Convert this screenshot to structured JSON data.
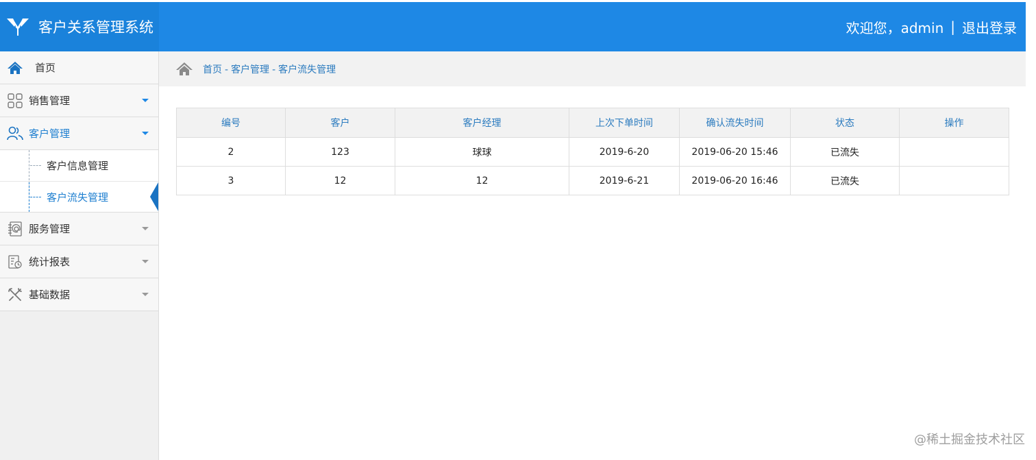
{
  "header": {
    "title": "客户关系管理系统",
    "welcome": "欢迎您，admin",
    "separator": "|",
    "logout": "退出登录"
  },
  "sidebar": {
    "home": "首页",
    "items": [
      {
        "label": "销售管理",
        "icon": "grid-icon"
      },
      {
        "label": "客户管理",
        "icon": "users-icon"
      },
      {
        "label": "服务管理",
        "icon": "contacts-book-icon"
      },
      {
        "label": "统计报表",
        "icon": "report-icon"
      },
      {
        "label": "基础数据",
        "icon": "tools-icon"
      }
    ],
    "submenu": [
      "客户信息管理",
      "客户流失管理"
    ]
  },
  "breadcrumb": [
    "首页",
    "客户管理",
    "客户流失管理"
  ],
  "breadcrumb_sep": "-",
  "table": {
    "columns": [
      "编号",
      "客户",
      "客户经理",
      "上次下单时间",
      "确认流失时间",
      "状态",
      "操作"
    ],
    "rows": [
      [
        "2",
        "123",
        "球球",
        "2019-6-20",
        "2019-06-20 15:46",
        "已流失",
        ""
      ],
      [
        "3",
        "12",
        "12",
        "2019-6-21",
        "2019-06-20 16:46",
        "已流失",
        ""
      ]
    ]
  },
  "watermark": "@稀土掘金技术社区",
  "colors": {
    "header": "#1e88e5",
    "link": "#2b7bbf",
    "sidebar_bg": "#f0f0f0"
  }
}
